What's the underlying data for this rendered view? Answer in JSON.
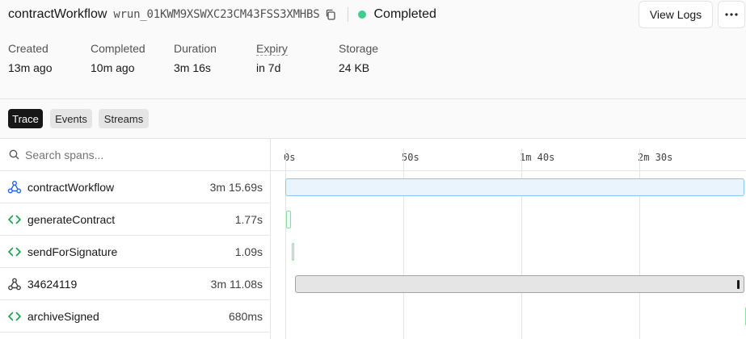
{
  "header": {
    "workflow_name": "contractWorkflow",
    "run_id": "wrun_01KWM9XSWXC23CM43FSS3XMHBS",
    "status": "Completed",
    "status_color": "#3ecf8e",
    "view_logs_label": "View Logs",
    "more_label": "⋯"
  },
  "meta": [
    {
      "label": "Created",
      "value": "13m ago"
    },
    {
      "label": "Completed",
      "value": "10m ago"
    },
    {
      "label": "Duration",
      "value": "3m 16s"
    },
    {
      "label": "Expiry",
      "value": "in 7d"
    },
    {
      "label": "Storage",
      "value": "24 KB"
    }
  ],
  "tabs": [
    {
      "label": "Trace",
      "active": true
    },
    {
      "label": "Events",
      "active": false
    },
    {
      "label": "Streams",
      "active": false
    }
  ],
  "search": {
    "placeholder": "Search spans..."
  },
  "timeline": {
    "ticks": [
      "0s",
      "50s",
      "1m 40s",
      "2m 30s"
    ],
    "tick_seconds": [
      0,
      50,
      100,
      150
    ],
    "total_seconds": 195.69
  },
  "spans": [
    {
      "name": "contractWorkflow",
      "duration": "3m 15.69s",
      "icon": "workflow-icon",
      "start_s": 0,
      "dur_s": 195.69,
      "kind": "workflow"
    },
    {
      "name": "generateContract",
      "duration": "1.77s",
      "icon": "code-icon",
      "start_s": 0.5,
      "dur_s": 1.77,
      "kind": "step"
    },
    {
      "name": "sendForSignature",
      "duration": "1.09s",
      "icon": "code-icon",
      "start_s": 2.6,
      "dur_s": 1.09,
      "kind": "step"
    },
    {
      "name": "34624119",
      "duration": "3m 11.08s",
      "icon": "webhook-icon",
      "start_s": 4.0,
      "dur_s": 191.08,
      "kind": "hook"
    },
    {
      "name": "archiveSigned",
      "duration": "680ms",
      "icon": "code-icon",
      "start_s": 194.9,
      "dur_s": 0.68,
      "kind": "step"
    }
  ],
  "colors": {
    "workflow_bar_fill": "#eaf4fd",
    "workflow_bar_border": "#8ec3ea",
    "step_bar_fill": "#ecfdf0",
    "step_bar_border": "#86e09a",
    "hook_bar_fill": "#e5e5e5",
    "hook_bar_border": "#a3a3a3"
  }
}
